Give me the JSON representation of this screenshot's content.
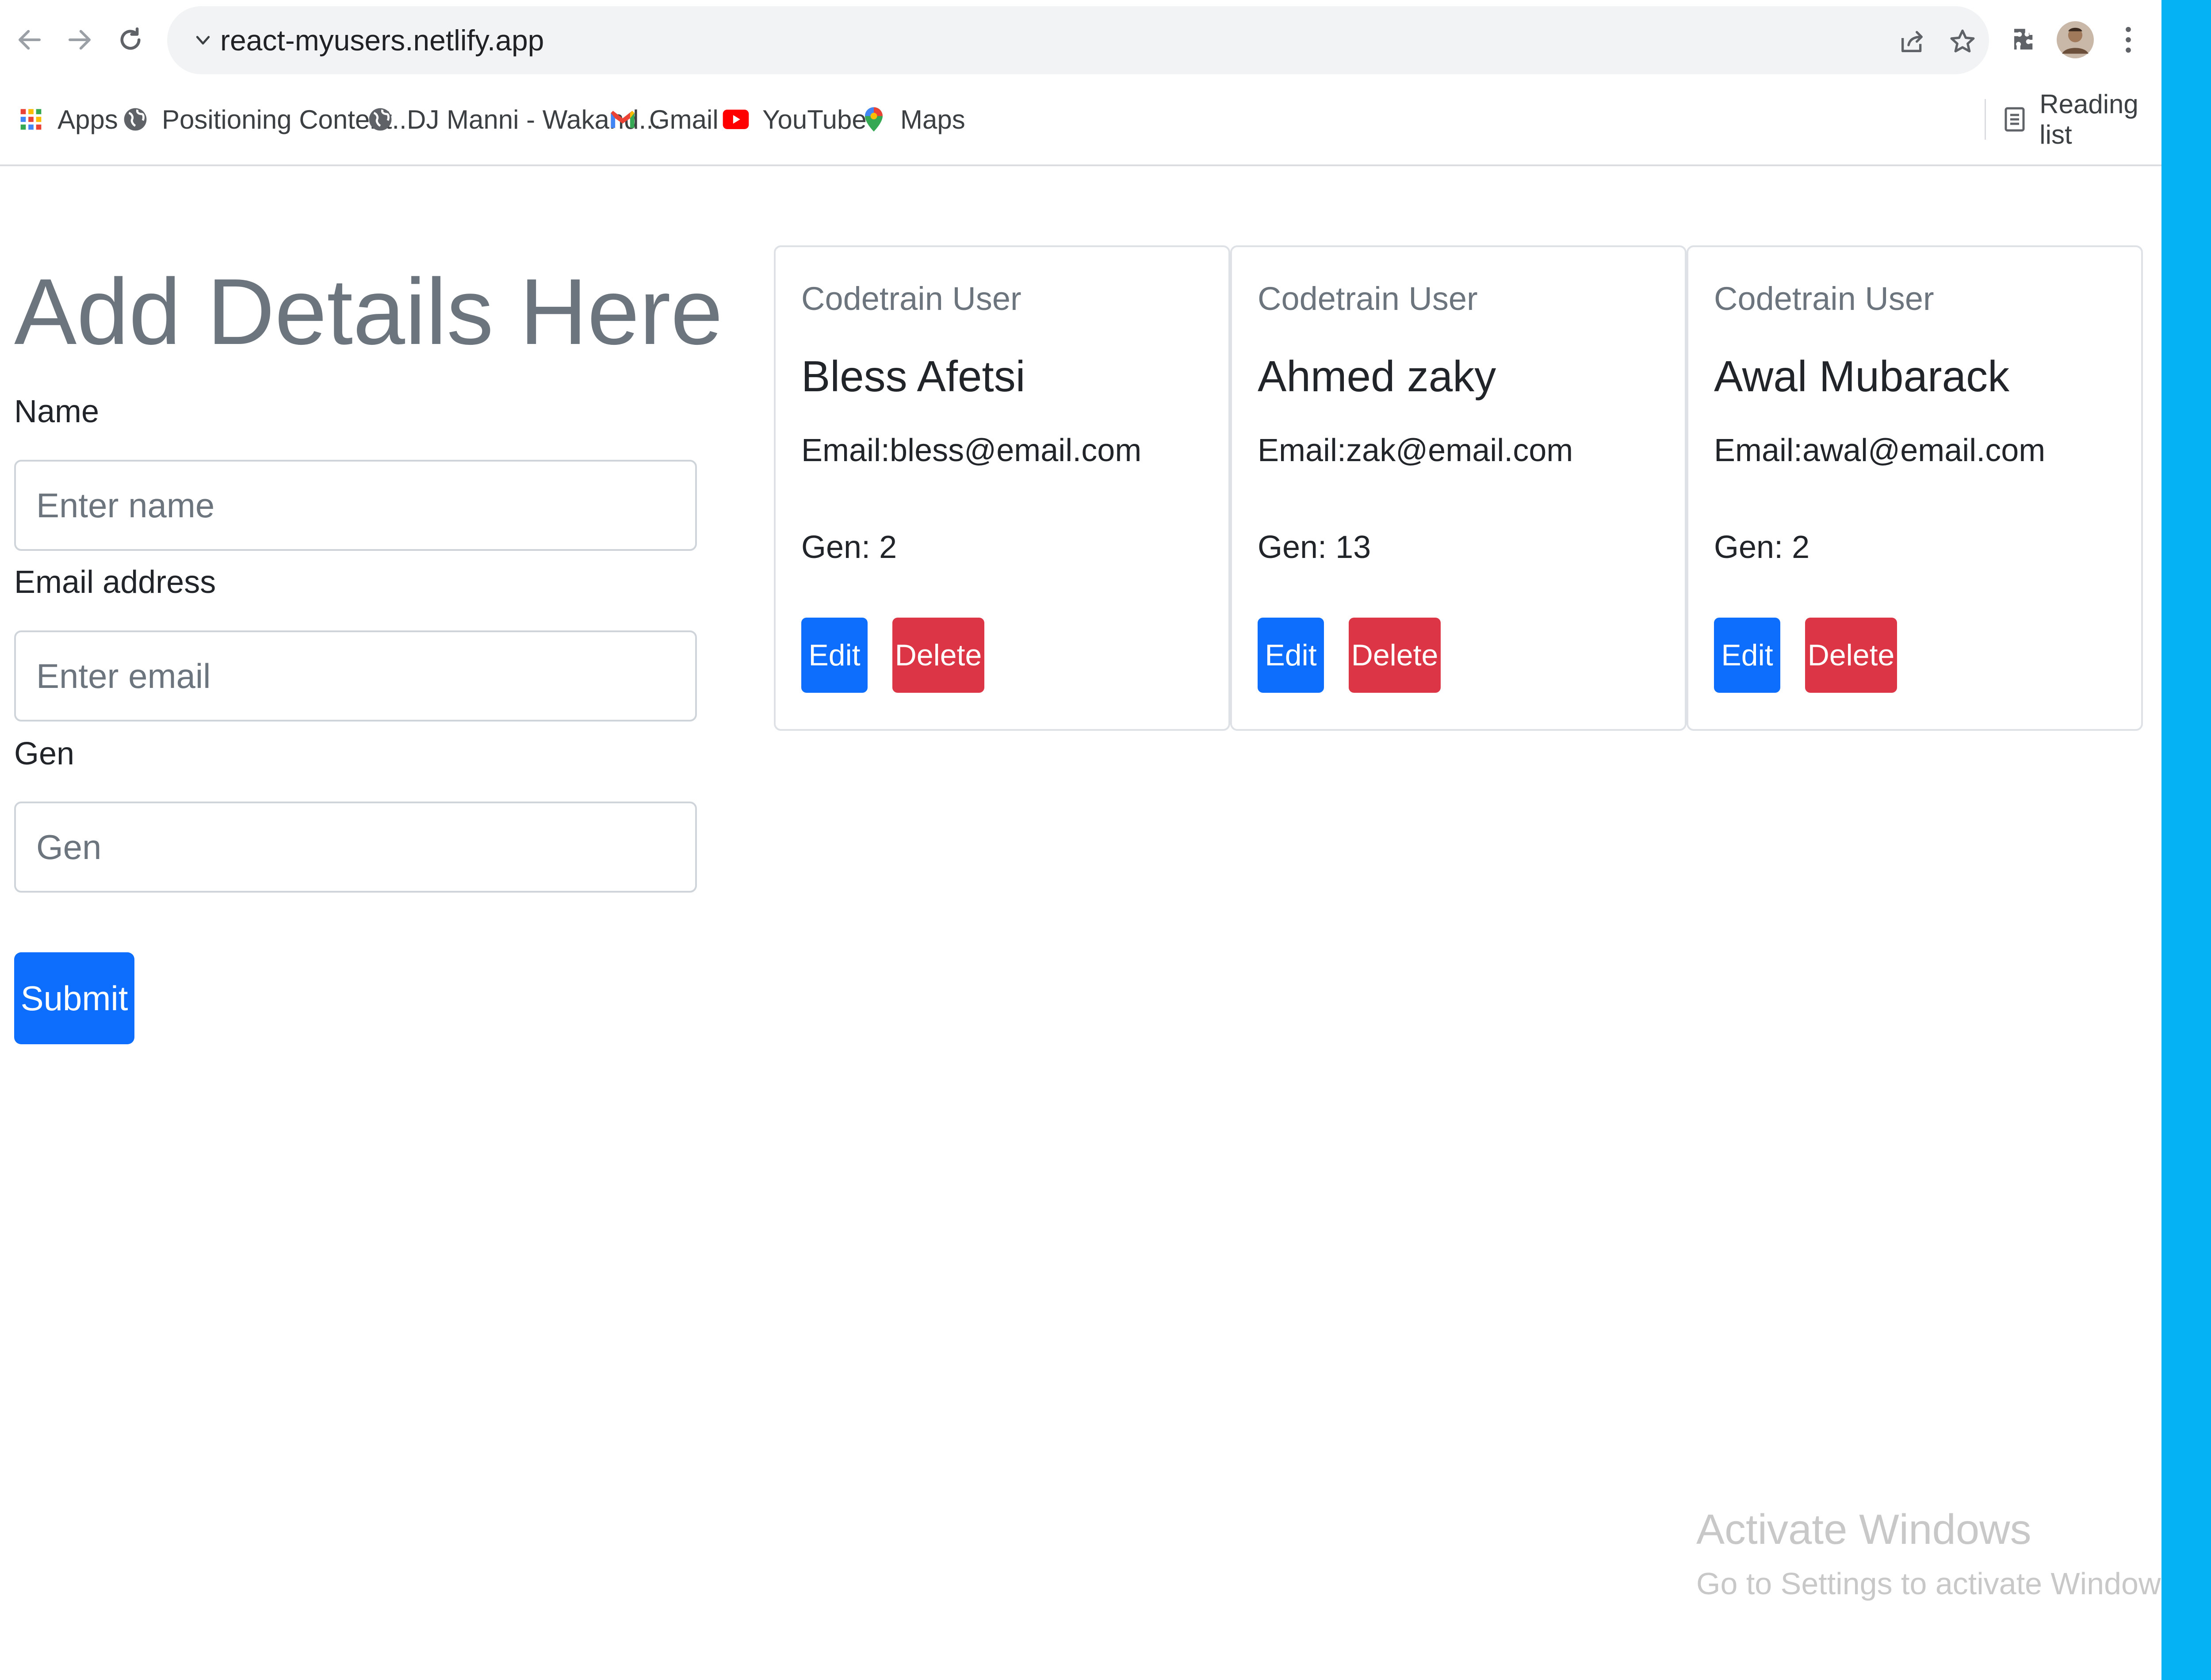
{
  "browser": {
    "url": "react-myusers.netlify.app",
    "bookmarks": [
      {
        "label": "Apps",
        "icon": "apps-grid-icon"
      },
      {
        "label": "Positioning Content...",
        "icon": "globe-icon"
      },
      {
        "label": "DJ Manni - Wakand...",
        "icon": "globe-icon"
      },
      {
        "label": "Gmail",
        "icon": "gmail-icon"
      },
      {
        "label": "YouTube",
        "icon": "youtube-icon"
      },
      {
        "label": "Maps",
        "icon": "maps-icon"
      }
    ],
    "reading_list_label": "Reading list"
  },
  "form": {
    "heading": "Add Details Here",
    "name_label": "Name",
    "name_placeholder": "Enter name",
    "email_label": "Email address",
    "email_placeholder": "Enter email",
    "gen_label": "Gen",
    "gen_placeholder": "Gen",
    "submit_label": "Submit"
  },
  "users": [
    {
      "subtitle": "Codetrain User",
      "name": "Bless Afetsi",
      "email": "Email:bless@email.com",
      "gen": "Gen: 2",
      "edit_label": "Edit",
      "delete_label": "Delete"
    },
    {
      "subtitle": "Codetrain User",
      "name": "Ahmed zaky",
      "email": "Email:zak@email.com",
      "gen": "Gen: 13",
      "edit_label": "Edit",
      "delete_label": "Delete"
    },
    {
      "subtitle": "Codetrain User",
      "name": "Awal Mubarack",
      "email": "Email:awal@email.com",
      "gen": "Gen: 2",
      "edit_label": "Edit",
      "delete_label": "Delete"
    }
  ],
  "watermark": {
    "title": "Activate Windows",
    "subtitle": "Go to Settings to activate Windows."
  },
  "colors": {
    "primary": "#0d6efd",
    "danger": "#dc3545",
    "heading_gray": "#6c757d",
    "desktop_accent": "#05b2f4"
  }
}
